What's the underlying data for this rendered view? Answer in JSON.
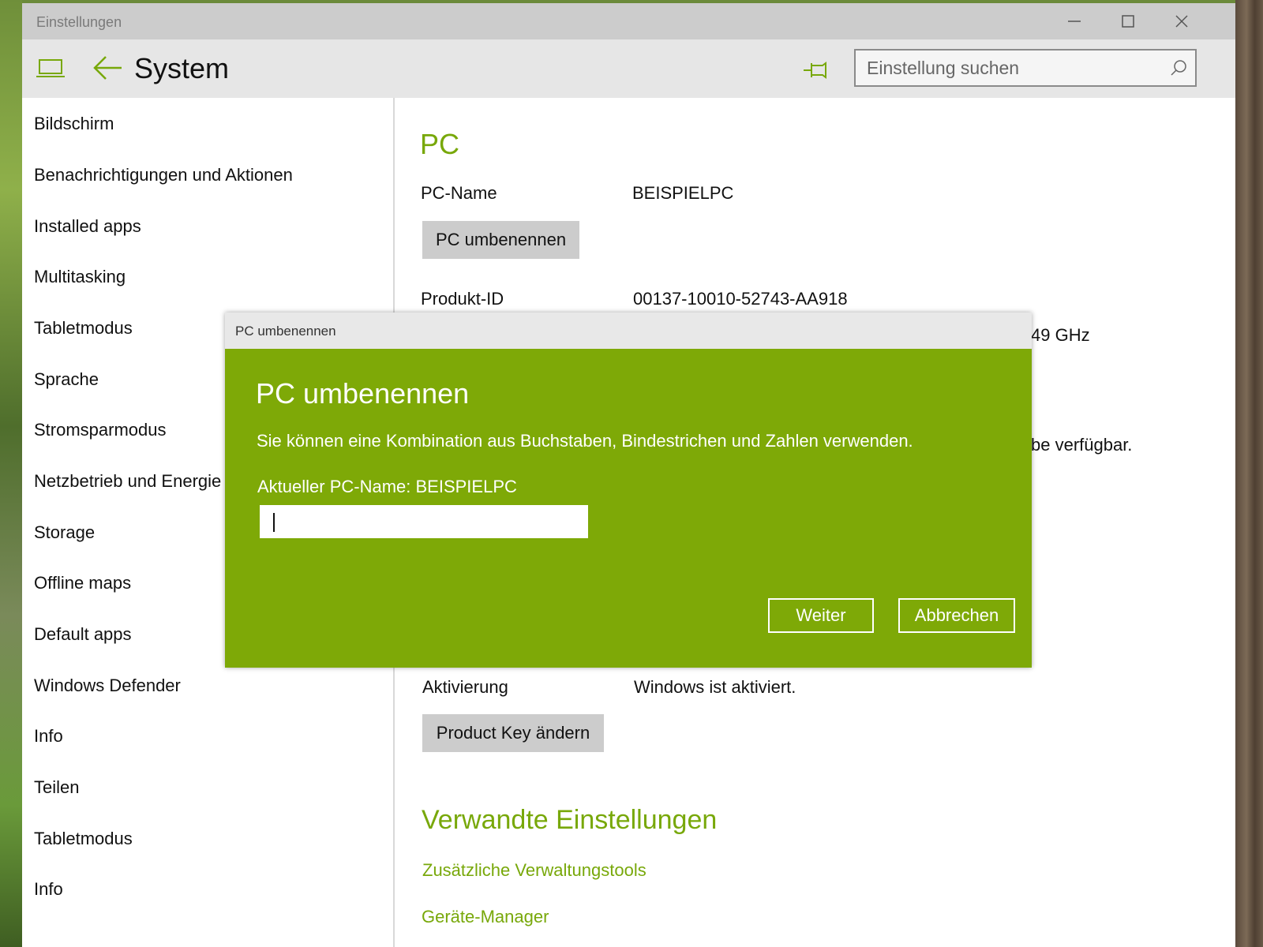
{
  "window": {
    "title": "Einstellungen",
    "controls": {
      "minimize": "—",
      "maximize": "☐",
      "close": "✕"
    }
  },
  "header": {
    "page_title": "System",
    "search_placeholder": "Einstellung suchen",
    "icons": [
      "laptop-icon",
      "back-arrow-icon",
      "pin-icon",
      "search-icon"
    ]
  },
  "sidebar": {
    "items": [
      {
        "label": "Bildschirm"
      },
      {
        "label": "Benachrichtigungen und Aktionen"
      },
      {
        "label": "Installed apps"
      },
      {
        "label": "Multitasking"
      },
      {
        "label": "Tabletmodus"
      },
      {
        "label": "Sprache"
      },
      {
        "label": "Stromsparmodus"
      },
      {
        "label": "Netzbetrieb und Energie"
      },
      {
        "label": "Storage"
      },
      {
        "label": "Offline maps"
      },
      {
        "label": "Default apps"
      },
      {
        "label": "Windows Defender"
      },
      {
        "label": "Info"
      },
      {
        "label": "Teilen"
      },
      {
        "label": "Tabletmodus"
      },
      {
        "label": "Info"
      }
    ]
  },
  "main": {
    "section_title": "PC",
    "pc_name_label": "PC-Name",
    "pc_name_value": "BEISPIELPC",
    "rename_button": "PC umbenennen",
    "product_id_label": "Produkt-ID",
    "product_id_value": "00137-10010-52743-AA918",
    "partial_processor_text": "49 GHz",
    "partial_pen_text": "be verfügbar.",
    "activation_label": "Aktivierung",
    "activation_value": "Windows ist aktiviert.",
    "product_key_button": "Product Key ändern",
    "related_title": "Verwandte Einstellungen",
    "links": [
      {
        "label": "Zusätzliche Verwaltungstools"
      },
      {
        "label": "Geräte-Manager"
      }
    ]
  },
  "dialog": {
    "window_title": "PC umbenennen",
    "heading": "PC umbenennen",
    "description": "Sie können eine Kombination aus Buchstaben, Bindestrichen und Zahlen verwenden.",
    "current_name": "Aktueller PC-Name: BEISPIELPC",
    "input_value": "",
    "next_button": "Weiter",
    "cancel_button": "Abbrechen"
  },
  "colors": {
    "accent": "#78a80a",
    "dialog_background": "#7ea907",
    "titlebar": "#cccccc",
    "header": "#e6e6e6",
    "button_gray": "#cccccc"
  }
}
